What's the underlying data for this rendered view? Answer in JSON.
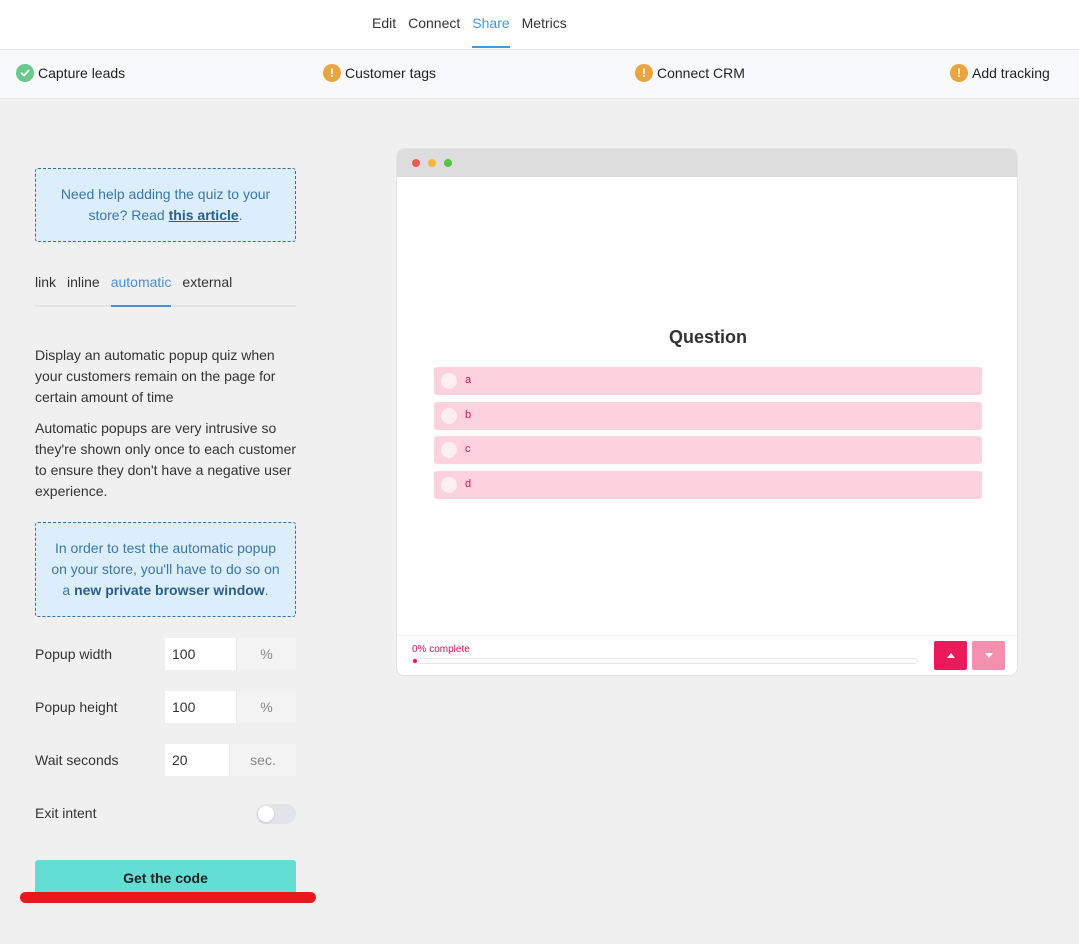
{
  "topnav": {
    "tabs": [
      {
        "label": "Edit"
      },
      {
        "label": "Connect"
      },
      {
        "label": "Share"
      },
      {
        "label": "Metrics"
      }
    ],
    "active": "Share"
  },
  "steps": [
    {
      "label": "Capture leads",
      "status": "done",
      "color": "#69c98b"
    },
    {
      "label": "Customer tags",
      "status": "warning",
      "color": "#e9a540"
    },
    {
      "label": "Connect CRM",
      "status": "warning",
      "color": "#e9a540"
    },
    {
      "label": "Add tracking",
      "status": "warning",
      "color": "#e9a540"
    }
  ],
  "help": {
    "text": "Need help adding the quiz to your store? Read ",
    "link": "this article",
    "suffix": "."
  },
  "share_tabs": [
    {
      "label": "link"
    },
    {
      "label": "inline"
    },
    {
      "label": "automatic"
    },
    {
      "label": "external"
    }
  ],
  "share_active": "automatic",
  "description": {
    "p1": "Display an automatic popup quiz when your customers remain on the page for certain amount of time",
    "p2": "Automatic popups are very intrusive so they're shown only once to each customer to ensure they don't have a negative user experience."
  },
  "test_note": {
    "text": "In order to test the automatic popup on your store, you'll have to do so on a ",
    "bold": "new private browser window",
    "suffix": "."
  },
  "fields": {
    "width": {
      "label": "Popup width",
      "value": "100",
      "unit": "%"
    },
    "height": {
      "label": "Popup height",
      "value": "100",
      "unit": "%"
    },
    "wait": {
      "label": "Wait seconds",
      "value": "20",
      "unit": "sec."
    },
    "exit_intent": {
      "label": "Exit intent",
      "enabled": false
    }
  },
  "cta": {
    "label": "Get the code"
  },
  "preview": {
    "question": "Question",
    "answers": [
      "a",
      "b",
      "c",
      "d"
    ],
    "progress_text": "0% complete",
    "progress": 0,
    "colors": {
      "accent": "#e61a5c",
      "answer_bg": "#fdd1dd"
    }
  }
}
